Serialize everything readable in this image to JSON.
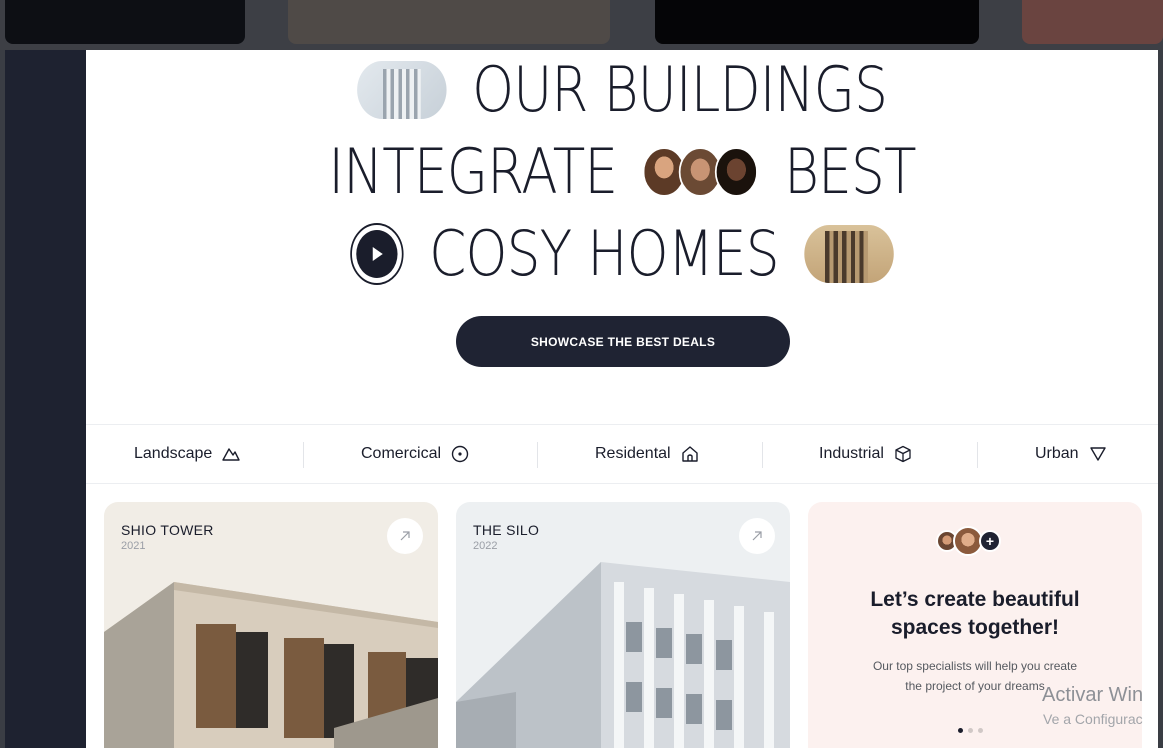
{
  "hero": {
    "line1": "OUR BUILDINGS",
    "line2a": "INTEGRATE",
    "line2b": "BEST",
    "line3": "COSY HOMES"
  },
  "cta_label": "SHOWCASE THE BEST DEALS",
  "categories": [
    {
      "label": "Landscape",
      "icon": "mountain-icon"
    },
    {
      "label": "Comercical",
      "icon": "target-icon"
    },
    {
      "label": "Residental",
      "icon": "house-icon"
    },
    {
      "label": "Industrial",
      "icon": "cube-icon"
    },
    {
      "label": "Urban",
      "icon": "triangle-down-icon"
    }
  ],
  "projects": [
    {
      "title": "SHIO TOWER",
      "year": "2021"
    },
    {
      "title": "THE SILO",
      "year": "2022"
    }
  ],
  "promo": {
    "title_line1": "Let’s create beautiful",
    "title_line2": "spaces together!",
    "text_line1": "Our top specialists will help you create",
    "text_line2": "the project of your dreams",
    "plus": "+"
  },
  "overlay": {
    "line1": "Activar Win",
    "line2": "Ve a Configurac"
  },
  "colors": {
    "primary": "#1f2333",
    "promo_bg": "#fcf1ef"
  }
}
